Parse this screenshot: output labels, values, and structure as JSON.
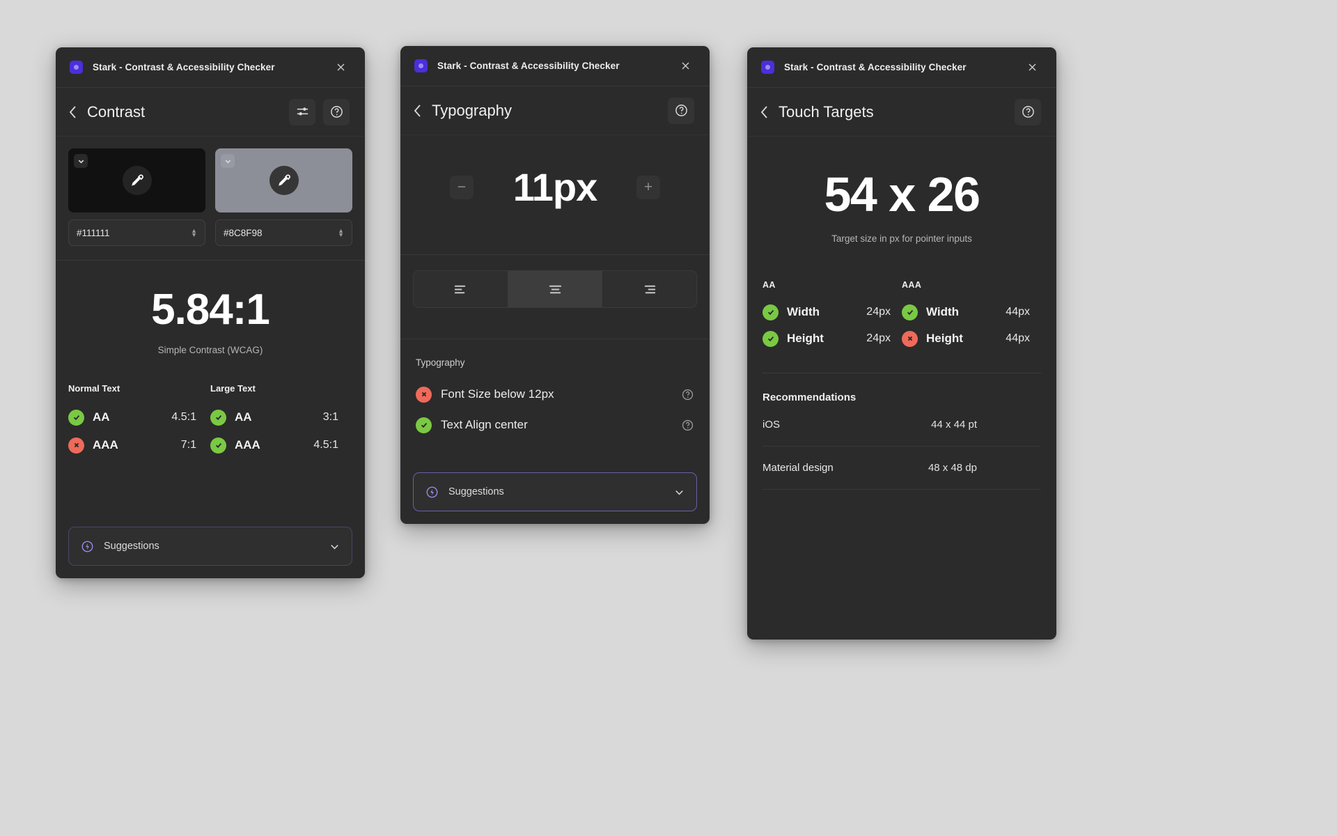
{
  "app": {
    "title": "Stark - Contrast & Accessibility Checker",
    "close_label": "✕"
  },
  "contrast_panel": {
    "nav_title": "Contrast",
    "settings_icon": "sliders-icon",
    "help_icon": "help-circle-icon",
    "foreground": {
      "hex": "#111111",
      "swatch_color": "#111111",
      "dropper_icon": "eyedropper-icon"
    },
    "background": {
      "hex": "#8C8F98",
      "swatch_color": "#8C8F98",
      "dropper_icon": "eyedropper-icon"
    },
    "ratio": "5.84:1",
    "ratio_caption": "Simple Contrast (WCAG)",
    "columns": [
      {
        "header": "Normal Text",
        "rows": [
          {
            "status": "pass",
            "level": "AA",
            "threshold": "4.5:1"
          },
          {
            "status": "fail",
            "level": "AAA",
            "threshold": "7:1"
          }
        ]
      },
      {
        "header": "Large Text",
        "rows": [
          {
            "status": "pass",
            "level": "AA",
            "threshold": "3:1"
          },
          {
            "status": "pass",
            "level": "AAA",
            "threshold": "4.5:1"
          }
        ]
      }
    ],
    "suggestions_label": "Suggestions"
  },
  "typography_panel": {
    "nav_title": "Typography",
    "help_icon": "help-circle-icon",
    "decrease_label": "−",
    "increase_label": "+",
    "font_size": "11px",
    "align_options": [
      {
        "name": "align-left",
        "selected": false
      },
      {
        "name": "align-center",
        "selected": true
      },
      {
        "name": "align-right",
        "selected": false
      }
    ],
    "list_title": "Typography",
    "issues": [
      {
        "status": "fail",
        "label": "Font Size below 12px"
      },
      {
        "status": "pass",
        "label": "Text Align center"
      }
    ],
    "suggestions_label": "Suggestions"
  },
  "touch_panel": {
    "nav_title": "Touch Targets",
    "help_icon": "help-circle-icon",
    "target_size": "54 x 26",
    "target_caption": "Target size in px for pointer inputs",
    "columns": [
      {
        "header": "AA",
        "rows": [
          {
            "status": "pass",
            "label": "Width",
            "value": "24px"
          },
          {
            "status": "pass",
            "label": "Height",
            "value": "24px"
          }
        ]
      },
      {
        "header": "AAA",
        "rows": [
          {
            "status": "pass",
            "label": "Width",
            "value": "44px"
          },
          {
            "status": "fail",
            "label": "Height",
            "value": "44px"
          }
        ]
      }
    ],
    "recommendations_title": "Recommendations",
    "recommendations": [
      {
        "name": "iOS",
        "value": "44 x 44 pt"
      },
      {
        "name": "Material design",
        "value": "48 x 48 dp"
      }
    ]
  },
  "colors": {
    "pass": "#7AC943",
    "fail": "#EF6A5A",
    "brand": "#4B2FDB",
    "panel_bg": "#2B2B2B",
    "page_bg": "#D9D9D9"
  }
}
